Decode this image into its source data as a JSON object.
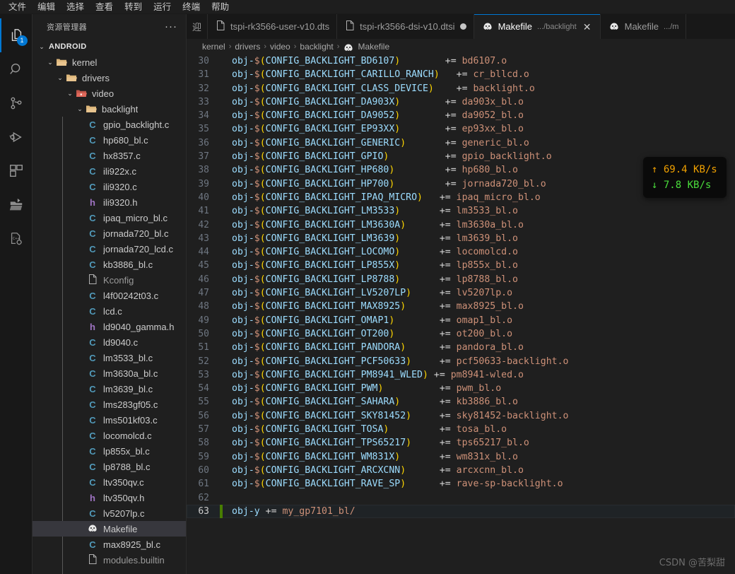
{
  "menubar": {
    "items": [
      "文件",
      "编辑",
      "选择",
      "查看",
      "转到",
      "运行",
      "终端",
      "帮助"
    ]
  },
  "activitybar": {
    "items": [
      {
        "name": "explorer",
        "icon": "files-icon",
        "badge": "1",
        "active": true
      },
      {
        "name": "search",
        "icon": "search-icon",
        "badge": "",
        "active": false
      },
      {
        "name": "source-control",
        "icon": "source-control-icon",
        "badge": "",
        "active": false
      },
      {
        "name": "run-debug",
        "icon": "run-and-debug-icon",
        "badge": "",
        "active": false
      },
      {
        "name": "extensions",
        "icon": "extensions-icon",
        "badge": "",
        "active": false
      },
      {
        "name": "remote-explorer",
        "icon": "remote-folder-icon",
        "badge": "",
        "active": false
      },
      {
        "name": "cpp-config",
        "icon": "cpp-gear-icon",
        "badge": "",
        "active": false
      }
    ]
  },
  "sidebar": {
    "title": "资源管理器",
    "more_label": "···",
    "root_label": "ANDROID",
    "root_twisty": "⌄",
    "folders": [
      {
        "label": "kernel",
        "depth": 1,
        "twisty": "⌄",
        "icon": "folder-open-icon",
        "color": "#dcb67a"
      },
      {
        "label": "drivers",
        "depth": 2,
        "twisty": "⌄",
        "icon": "folder-open-icon",
        "color": "#dcb67a"
      },
      {
        "label": "video",
        "depth": 3,
        "twisty": "⌄",
        "icon": "folder-open-video-icon",
        "color": "#e06c5d"
      },
      {
        "label": "backlight",
        "depth": 4,
        "twisty": "⌄",
        "icon": "folder-open-icon",
        "color": "#dcb67a"
      }
    ],
    "files": [
      {
        "label": "gpio_backlight.c",
        "icon": "c-file-icon",
        "type": "c",
        "selected": false
      },
      {
        "label": "hp680_bl.c",
        "icon": "c-file-icon",
        "type": "c",
        "selected": false
      },
      {
        "label": "hx8357.c",
        "icon": "c-file-icon",
        "type": "c",
        "selected": false
      },
      {
        "label": "ili922x.c",
        "icon": "c-file-icon",
        "type": "c",
        "selected": false
      },
      {
        "label": "ili9320.c",
        "icon": "c-file-icon",
        "type": "c",
        "selected": false
      },
      {
        "label": "ili9320.h",
        "icon": "h-file-icon",
        "type": "h",
        "selected": false
      },
      {
        "label": "ipaq_micro_bl.c",
        "icon": "c-file-icon",
        "type": "c",
        "selected": false
      },
      {
        "label": "jornada720_bl.c",
        "icon": "c-file-icon",
        "type": "c",
        "selected": false
      },
      {
        "label": "jornada720_lcd.c",
        "icon": "c-file-icon",
        "type": "c",
        "selected": false
      },
      {
        "label": "kb3886_bl.c",
        "icon": "c-file-icon",
        "type": "c",
        "selected": false
      },
      {
        "label": "Kconfig",
        "icon": "plain-file-icon",
        "type": "plain",
        "selected": false
      },
      {
        "label": "l4f00242t03.c",
        "icon": "c-file-icon",
        "type": "c",
        "selected": false
      },
      {
        "label": "lcd.c",
        "icon": "c-file-icon",
        "type": "c",
        "selected": false
      },
      {
        "label": "ld9040_gamma.h",
        "icon": "h-file-icon",
        "type": "h",
        "selected": false
      },
      {
        "label": "ld9040.c",
        "icon": "c-file-icon",
        "type": "c",
        "selected": false
      },
      {
        "label": "lm3533_bl.c",
        "icon": "c-file-icon",
        "type": "c",
        "selected": false
      },
      {
        "label": "lm3630a_bl.c",
        "icon": "c-file-icon",
        "type": "c",
        "selected": false
      },
      {
        "label": "lm3639_bl.c",
        "icon": "c-file-icon",
        "type": "c",
        "selected": false
      },
      {
        "label": "lms283gf05.c",
        "icon": "c-file-icon",
        "type": "c",
        "selected": false
      },
      {
        "label": "lms501kf03.c",
        "icon": "c-file-icon",
        "type": "c",
        "selected": false
      },
      {
        "label": "locomolcd.c",
        "icon": "c-file-icon",
        "type": "c",
        "selected": false
      },
      {
        "label": "lp855x_bl.c",
        "icon": "c-file-icon",
        "type": "c",
        "selected": false
      },
      {
        "label": "lp8788_bl.c",
        "icon": "c-file-icon",
        "type": "c",
        "selected": false
      },
      {
        "label": "ltv350qv.c",
        "icon": "c-file-icon",
        "type": "c",
        "selected": false
      },
      {
        "label": "ltv350qv.h",
        "icon": "h-file-icon",
        "type": "h",
        "selected": false
      },
      {
        "label": "lv5207lp.c",
        "icon": "c-file-icon",
        "type": "c",
        "selected": false
      },
      {
        "label": "Makefile",
        "icon": "makefile-icon",
        "type": "make",
        "selected": true
      },
      {
        "label": "max8925_bl.c",
        "icon": "c-file-icon",
        "type": "c",
        "selected": false
      },
      {
        "label": "modules.builtin",
        "icon": "plain-file-icon",
        "type": "plain",
        "selected": false
      }
    ]
  },
  "tabs": [
    {
      "name": "welcome",
      "label": "迎",
      "path": "",
      "icon": "welcome-icon",
      "active": false,
      "dirty": false,
      "closable": false
    },
    {
      "name": "tspi-rk3566-user-v10.dts",
      "label": "tspi-rk3566-user-v10.dts",
      "path": "",
      "icon": "plain-file-icon",
      "active": false,
      "dirty": false,
      "closable": false
    },
    {
      "name": "tspi-rk3566-dsi-v10.dtsi",
      "label": "tspi-rk3566-dsi-v10.dtsi",
      "path": "",
      "icon": "plain-file-icon",
      "active": false,
      "dirty": true,
      "closable": false
    },
    {
      "name": "makefile-backlight",
      "label": "Makefile",
      "path": ".../backlight",
      "icon": "makefile-icon",
      "active": true,
      "dirty": false,
      "closable": true,
      "close_label": "✕"
    },
    {
      "name": "makefile-other",
      "label": "Makefile",
      "path": ".../m",
      "icon": "makefile-icon",
      "active": false,
      "dirty": false,
      "closable": false
    }
  ],
  "breadcrumb": {
    "separator": "›",
    "items": [
      "kernel",
      "drivers",
      "video",
      "backlight",
      "Makefile"
    ]
  },
  "editor": {
    "first_line": 30,
    "lines": [
      {
        "n": 30,
        "prefix": "obj-",
        "dollar": "$",
        "open": "(",
        "cfg": "CONFIG_BACKLIGHT_BD6107",
        "close": ")",
        "gap": "        ",
        "op": "+=",
        "val": " bd6107.o",
        "active": false,
        "git": ""
      },
      {
        "n": 31,
        "prefix": "obj-",
        "dollar": "$",
        "open": "(",
        "cfg": "CONFIG_BACKLIGHT_CARILLO_RANCH",
        "close": ")",
        "gap": "   ",
        "op": "+=",
        "val": " cr_bllcd.o",
        "active": false,
        "git": ""
      },
      {
        "n": 32,
        "prefix": "obj-",
        "dollar": "$",
        "open": "(",
        "cfg": "CONFIG_BACKLIGHT_CLASS_DEVICE",
        "close": ")",
        "gap": "    ",
        "op": "+=",
        "val": " backlight.o",
        "active": false,
        "git": ""
      },
      {
        "n": 33,
        "prefix": "obj-",
        "dollar": "$",
        "open": "(",
        "cfg": "CONFIG_BACKLIGHT_DA903X",
        "close": ")",
        "gap": "        ",
        "op": "+=",
        "val": " da903x_bl.o",
        "active": false,
        "git": ""
      },
      {
        "n": 34,
        "prefix": "obj-",
        "dollar": "$",
        "open": "(",
        "cfg": "CONFIG_BACKLIGHT_DA9052",
        "close": ")",
        "gap": "        ",
        "op": "+=",
        "val": " da9052_bl.o",
        "active": false,
        "git": ""
      },
      {
        "n": 35,
        "prefix": "obj-",
        "dollar": "$",
        "open": "(",
        "cfg": "CONFIG_BACKLIGHT_EP93XX",
        "close": ")",
        "gap": "        ",
        "op": "+=",
        "val": " ep93xx_bl.o",
        "active": false,
        "git": ""
      },
      {
        "n": 36,
        "prefix": "obj-",
        "dollar": "$",
        "open": "(",
        "cfg": "CONFIG_BACKLIGHT_GENERIC",
        "close": ")",
        "gap": "       ",
        "op": "+=",
        "val": " generic_bl.o",
        "active": false,
        "git": ""
      },
      {
        "n": 37,
        "prefix": "obj-",
        "dollar": "$",
        "open": "(",
        "cfg": "CONFIG_BACKLIGHT_GPIO",
        "close": ")",
        "gap": "          ",
        "op": "+=",
        "val": " gpio_backlight.o",
        "active": false,
        "git": ""
      },
      {
        "n": 38,
        "prefix": "obj-",
        "dollar": "$",
        "open": "(",
        "cfg": "CONFIG_BACKLIGHT_HP680",
        "close": ")",
        "gap": "         ",
        "op": "+=",
        "val": " hp680_bl.o",
        "active": false,
        "git": ""
      },
      {
        "n": 39,
        "prefix": "obj-",
        "dollar": "$",
        "open": "(",
        "cfg": "CONFIG_BACKLIGHT_HP700",
        "close": ")",
        "gap": "         ",
        "op": "+=",
        "val": " jornada720_bl.o",
        "active": false,
        "git": ""
      },
      {
        "n": 40,
        "prefix": "obj-",
        "dollar": "$",
        "open": "(",
        "cfg": "CONFIG_BACKLIGHT_IPAQ_MICRO",
        "close": ")",
        "gap": "   ",
        "op": "+=",
        "val": " ipaq_micro_bl.o",
        "active": false,
        "git": ""
      },
      {
        "n": 41,
        "prefix": "obj-",
        "dollar": "$",
        "open": "(",
        "cfg": "CONFIG_BACKLIGHT_LM3533",
        "close": ")",
        "gap": "       ",
        "op": "+=",
        "val": " lm3533_bl.o",
        "active": false,
        "git": ""
      },
      {
        "n": 42,
        "prefix": "obj-",
        "dollar": "$",
        "open": "(",
        "cfg": "CONFIG_BACKLIGHT_LM3630A",
        "close": ")",
        "gap": "      ",
        "op": "+=",
        "val": " lm3630a_bl.o",
        "active": false,
        "git": ""
      },
      {
        "n": 43,
        "prefix": "obj-",
        "dollar": "$",
        "open": "(",
        "cfg": "CONFIG_BACKLIGHT_LM3639",
        "close": ")",
        "gap": "       ",
        "op": "+=",
        "val": " lm3639_bl.o",
        "active": false,
        "git": ""
      },
      {
        "n": 44,
        "prefix": "obj-",
        "dollar": "$",
        "open": "(",
        "cfg": "CONFIG_BACKLIGHT_LOCOMO",
        "close": ")",
        "gap": "       ",
        "op": "+=",
        "val": " locomolcd.o",
        "active": false,
        "git": ""
      },
      {
        "n": 45,
        "prefix": "obj-",
        "dollar": "$",
        "open": "(",
        "cfg": "CONFIG_BACKLIGHT_LP855X",
        "close": ")",
        "gap": "       ",
        "op": "+=",
        "val": " lp855x_bl.o",
        "active": false,
        "git": ""
      },
      {
        "n": 46,
        "prefix": "obj-",
        "dollar": "$",
        "open": "(",
        "cfg": "CONFIG_BACKLIGHT_LP8788",
        "close": ")",
        "gap": "       ",
        "op": "+=",
        "val": " lp8788_bl.o",
        "active": false,
        "git": ""
      },
      {
        "n": 47,
        "prefix": "obj-",
        "dollar": "$",
        "open": "(",
        "cfg": "CONFIG_BACKLIGHT_LV5207LP",
        "close": ")",
        "gap": "     ",
        "op": "+=",
        "val": " lv5207lp.o",
        "active": false,
        "git": ""
      },
      {
        "n": 48,
        "prefix": "obj-",
        "dollar": "$",
        "open": "(",
        "cfg": "CONFIG_BACKLIGHT_MAX8925",
        "close": ")",
        "gap": "      ",
        "op": "+=",
        "val": " max8925_bl.o",
        "active": false,
        "git": ""
      },
      {
        "n": 49,
        "prefix": "obj-",
        "dollar": "$",
        "open": "(",
        "cfg": "CONFIG_BACKLIGHT_OMAP1",
        "close": ")",
        "gap": "        ",
        "op": "+=",
        "val": " omap1_bl.o",
        "active": false,
        "git": ""
      },
      {
        "n": 50,
        "prefix": "obj-",
        "dollar": "$",
        "open": "(",
        "cfg": "CONFIG_BACKLIGHT_OT200",
        "close": ")",
        "gap": "        ",
        "op": "+=",
        "val": " ot200_bl.o",
        "active": false,
        "git": ""
      },
      {
        "n": 51,
        "prefix": "obj-",
        "dollar": "$",
        "open": "(",
        "cfg": "CONFIG_BACKLIGHT_PANDORA",
        "close": ")",
        "gap": "      ",
        "op": "+=",
        "val": " pandora_bl.o",
        "active": false,
        "git": ""
      },
      {
        "n": 52,
        "prefix": "obj-",
        "dollar": "$",
        "open": "(",
        "cfg": "CONFIG_BACKLIGHT_PCF50633",
        "close": ")",
        "gap": "     ",
        "op": "+=",
        "val": " pcf50633-backlight.o",
        "active": false,
        "git": ""
      },
      {
        "n": 53,
        "prefix": "obj-",
        "dollar": "$",
        "open": "(",
        "cfg": "CONFIG_BACKLIGHT_PM8941_WLED",
        "close": ")",
        "gap": " ",
        "op": "+=",
        "val": " pm8941-wled.o",
        "active": false,
        "git": ""
      },
      {
        "n": 54,
        "prefix": "obj-",
        "dollar": "$",
        "open": "(",
        "cfg": "CONFIG_BACKLIGHT_PWM",
        "close": ")",
        "gap": "          ",
        "op": "+=",
        "val": " pwm_bl.o",
        "active": false,
        "git": ""
      },
      {
        "n": 55,
        "prefix": "obj-",
        "dollar": "$",
        "open": "(",
        "cfg": "CONFIG_BACKLIGHT_SAHARA",
        "close": ")",
        "gap": "       ",
        "op": "+=",
        "val": " kb3886_bl.o",
        "active": false,
        "git": ""
      },
      {
        "n": 56,
        "prefix": "obj-",
        "dollar": "$",
        "open": "(",
        "cfg": "CONFIG_BACKLIGHT_SKY81452",
        "close": ")",
        "gap": "     ",
        "op": "+=",
        "val": " sky81452-backlight.o",
        "active": false,
        "git": ""
      },
      {
        "n": 57,
        "prefix": "obj-",
        "dollar": "$",
        "open": "(",
        "cfg": "CONFIG_BACKLIGHT_TOSA",
        "close": ")",
        "gap": "         ",
        "op": "+=",
        "val": " tosa_bl.o",
        "active": false,
        "git": ""
      },
      {
        "n": 58,
        "prefix": "obj-",
        "dollar": "$",
        "open": "(",
        "cfg": "CONFIG_BACKLIGHT_TPS65217",
        "close": ")",
        "gap": "     ",
        "op": "+=",
        "val": " tps65217_bl.o",
        "active": false,
        "git": ""
      },
      {
        "n": 59,
        "prefix": "obj-",
        "dollar": "$",
        "open": "(",
        "cfg": "CONFIG_BACKLIGHT_WM831X",
        "close": ")",
        "gap": "       ",
        "op": "+=",
        "val": " wm831x_bl.o",
        "active": false,
        "git": ""
      },
      {
        "n": 60,
        "prefix": "obj-",
        "dollar": "$",
        "open": "(",
        "cfg": "CONFIG_BACKLIGHT_ARCXCNN",
        "close": ")",
        "gap": "      ",
        "op": "+=",
        "val": " arcxcnn_bl.o",
        "active": false,
        "git": ""
      },
      {
        "n": 61,
        "prefix": "obj-",
        "dollar": "$",
        "open": "(",
        "cfg": "CONFIG_BACKLIGHT_RAVE_SP",
        "close": ")",
        "gap": "      ",
        "op": "+=",
        "val": " rave-sp-backlight.o",
        "active": false,
        "git": ""
      },
      {
        "n": 62,
        "prefix": "",
        "dollar": "",
        "open": "",
        "cfg": "",
        "close": "",
        "gap": "",
        "op": "",
        "val": "",
        "active": false,
        "git": ""
      },
      {
        "n": 63,
        "prefix": "obj-y ",
        "dollar": "",
        "open": "",
        "cfg": "",
        "close": "",
        "gap": "",
        "op": "+=",
        "val": " my_gp7101_bl/",
        "active": true,
        "git": "added"
      }
    ]
  },
  "network_widget": {
    "up_arrow": "↑",
    "up_value": "69.4 KB/s",
    "down_arrow": "↓",
    "down_value": "7.8 KB/s",
    "up_color": "#f0a000",
    "down_color": "#4ade3c"
  },
  "watermark": "CSDN @苦梨甜"
}
